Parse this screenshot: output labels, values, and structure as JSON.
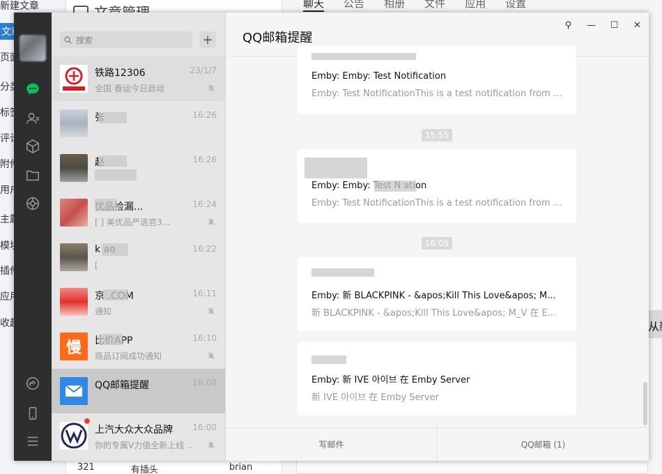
{
  "background": {
    "left_menu": [
      "新建文章",
      "文章",
      "页面",
      "分类",
      "标签",
      "评论",
      "附件",
      "用户",
      "主题",
      "模块",
      "插件",
      "应用",
      "收起"
    ],
    "page_title": "文章管理",
    "tabs": [
      "聊天",
      "公告",
      "相册",
      "文件",
      "应用",
      "设置"
    ],
    "side_button": "从新",
    "table_row": [
      "321",
      "有插头",
      "brian"
    ]
  },
  "search": {
    "placeholder": "搜索"
  },
  "conversations": [
    {
      "name": "铁路12306",
      "time": "23/1/7",
      "preview": "全国   春运今日启动"
    },
    {
      "name": "张",
      "time": "16:26",
      "preview": ""
    },
    {
      "name": "赵",
      "time": "16:26",
      "preview": ""
    },
    {
      "name": "优品捡漏...",
      "time": "16:24",
      "preview": "[  ]  美优品严选官3..."
    },
    {
      "name": "k    ao",
      "time": "16:22",
      "preview": "["
    },
    {
      "name": "京     .COM",
      "time": "16:11",
      "preview": "     通知"
    },
    {
      "name": "      比价APP",
      "time": "16:10",
      "preview": "商品订阅成功通知"
    },
    {
      "name": "QQ邮箱提醒",
      "time": "16:08",
      "preview": ""
    },
    {
      "name": "上汽大众大众品牌",
      "time": "16:00",
      "preview": "你的专属V力值全新上线 ..."
    }
  ],
  "chat": {
    "title": "QQ邮箱提醒",
    "messages": [
      {
        "heading": "Emby: Emby: Test Notification",
        "detail": "Emby: Test NotificationThis is a test notification from ..."
      },
      {
        "stamp": "15:55",
        "heading": "Emby: Emby: Test N     ation",
        "detail": "Emby: Test NotificationThis is a test notification from ..."
      },
      {
        "stamp": "16:05",
        "heading": "Emby: 新 BLACKPINK - &apos;Kill This Love&apos; M...",
        "detail": "新 BLACKPINK - &apos;Kill This Love&apos; M_V 在 E..."
      },
      {
        "heading": "Emby: 新 IVE 아이브 在 Emby Server",
        "detail": "新 IVE 아이브 在 Emby Server"
      }
    ],
    "footer": {
      "compose": "写邮件",
      "mailbox": "QQ邮箱 (1)"
    }
  }
}
